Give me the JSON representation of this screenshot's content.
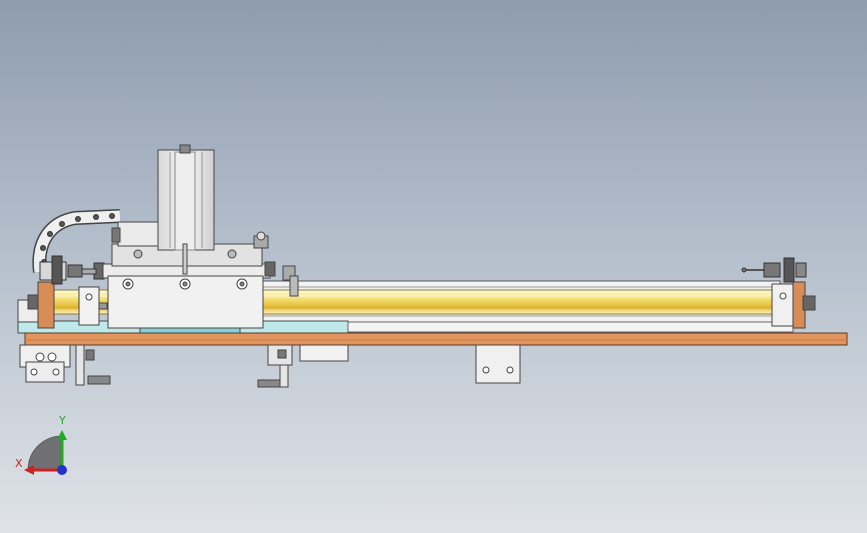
{
  "triad": {
    "x_label": "X",
    "y_label": "Y",
    "x_color": "#cc2222",
    "y_color": "#22aa22",
    "z_color": "#2233cc"
  },
  "colors": {
    "background_top": "#8e9cae",
    "background_bottom": "#dfe3e7",
    "base_plate": "#e09060",
    "carriage_plate": "#b8e6e8",
    "rod": "#f1dc6e",
    "metal": "#e4e4e4",
    "outline": "#4a4a4a"
  }
}
